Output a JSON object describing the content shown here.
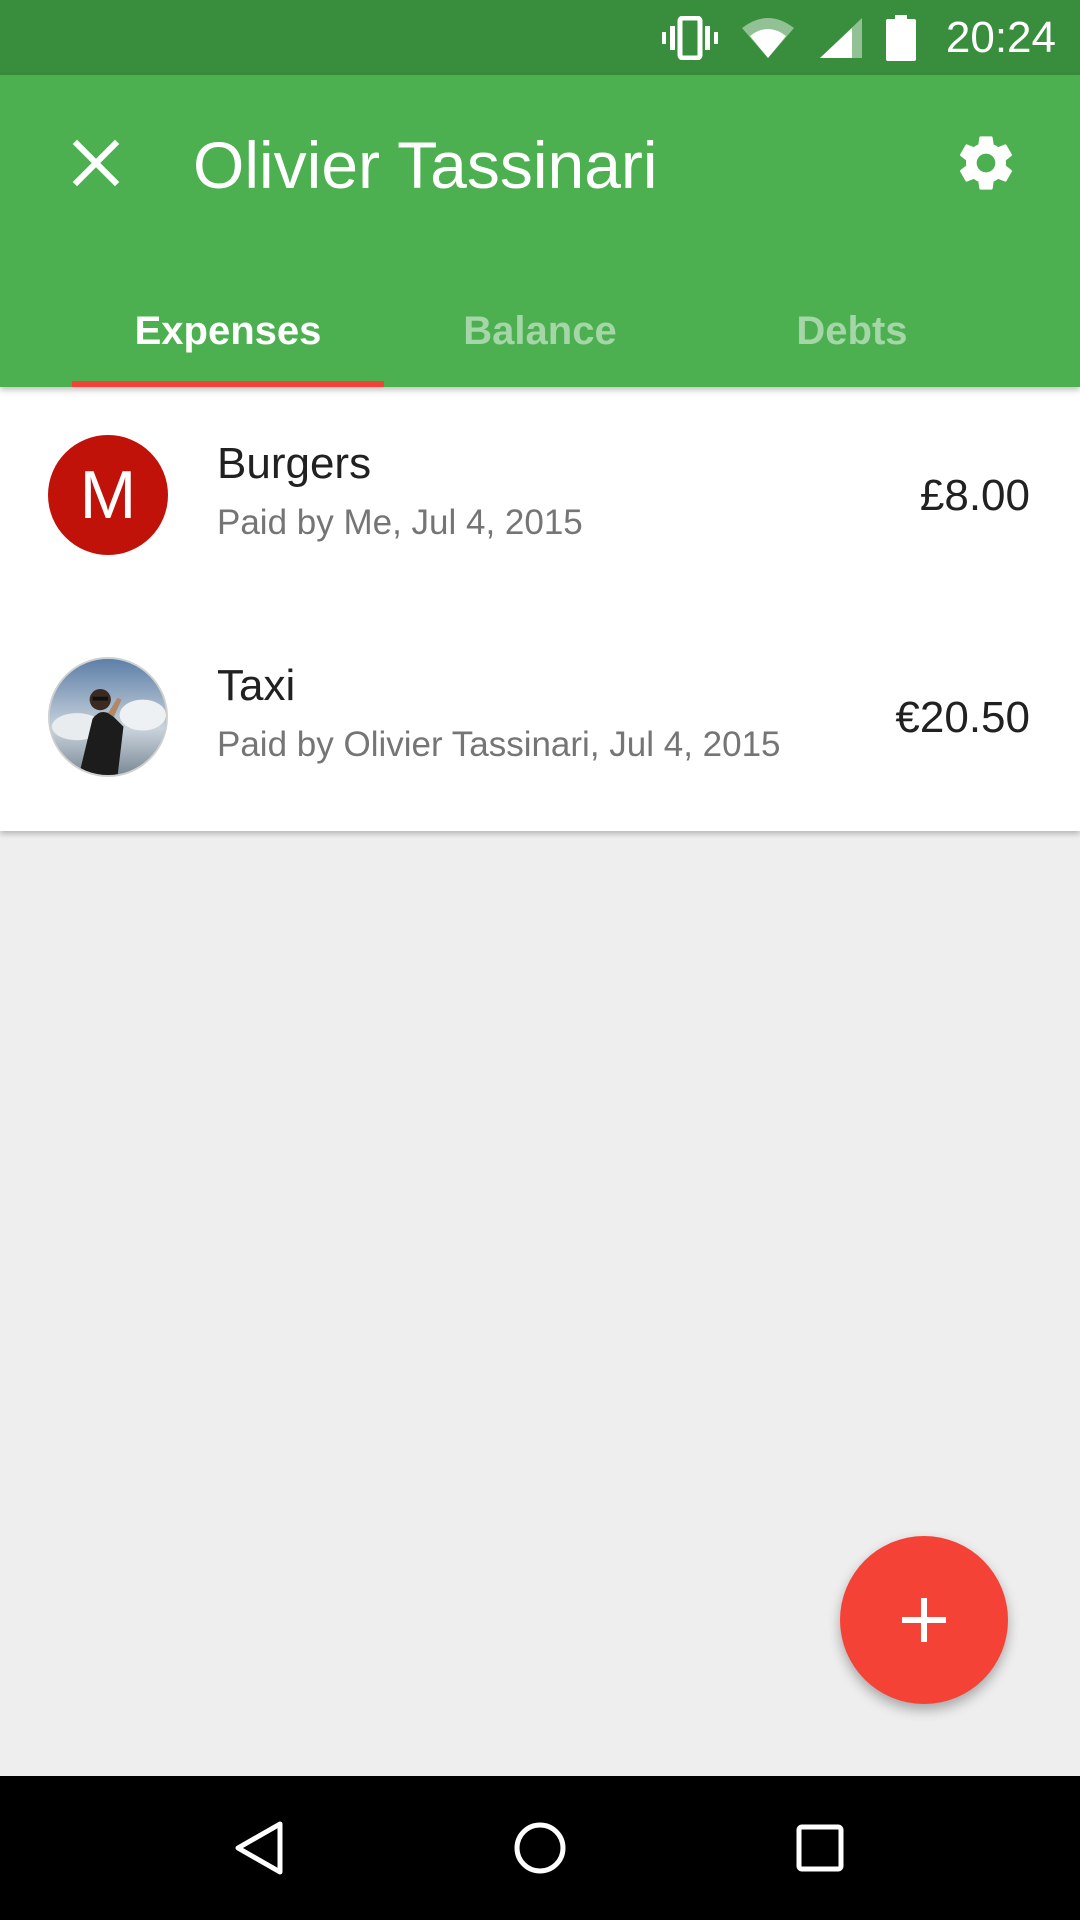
{
  "status_bar": {
    "time": "20:24",
    "icons": [
      "vibrate-icon",
      "wifi-icon",
      "cell-signal-icon",
      "battery-icon"
    ]
  },
  "app_bar": {
    "title": "Olivier Tassinari",
    "close_icon": "close-icon",
    "settings_icon": "gear-icon",
    "color": "#4caf50"
  },
  "tabs": [
    {
      "label": "Expenses",
      "active": true
    },
    {
      "label": "Balance",
      "active": false
    },
    {
      "label": "Debts",
      "active": false
    }
  ],
  "expenses": [
    {
      "avatar_letter": "M",
      "title": "Burgers",
      "subtitle": "Paid by Me, Jul 4, 2015",
      "amount": "£8.00"
    },
    {
      "avatar_letter": "",
      "title": "Taxi",
      "subtitle": "Paid by Olivier Tassinari, Jul 4, 2015",
      "amount": "€20.50"
    }
  ],
  "fab": {
    "icon": "plus-icon",
    "color": "#f44336"
  },
  "nav_bar": {
    "icons": [
      "back-icon",
      "home-icon",
      "recents-icon"
    ]
  },
  "colors": {
    "status_bar": "#388e3c",
    "accent": "#f44336",
    "avatar_m": "#c1120a"
  }
}
